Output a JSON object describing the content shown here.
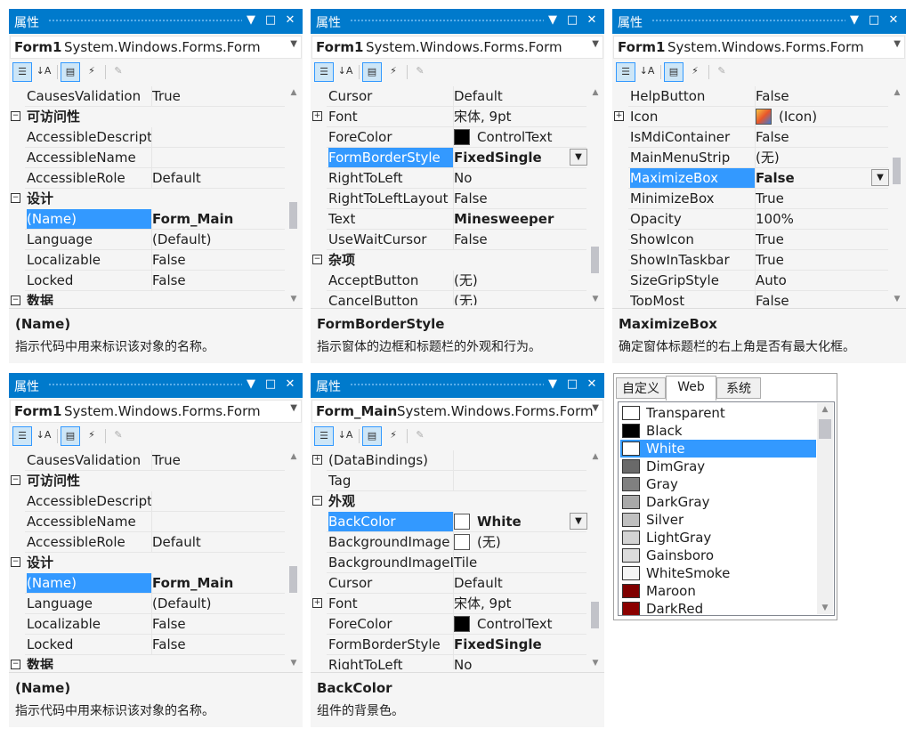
{
  "panes": [
    {
      "title": "属性",
      "object_name": "Form1",
      "object_type": "System.Windows.Forms.Form",
      "rows": [
        {
          "name": "CausesValidation",
          "value": "True"
        },
        {
          "name": "可访问性",
          "category": true
        },
        {
          "name": "AccessibleDescript",
          "value": ""
        },
        {
          "name": "AccessibleName",
          "value": ""
        },
        {
          "name": "AccessibleRole",
          "value": "Default"
        },
        {
          "name": "设计",
          "category": true
        },
        {
          "name": "(Name)",
          "value": "Form_Main",
          "selected": true,
          "bold": true
        },
        {
          "name": "Language",
          "value": "(Default)"
        },
        {
          "name": "Localizable",
          "value": "False"
        },
        {
          "name": "Locked",
          "value": "False"
        },
        {
          "name": "数据",
          "category": true
        }
      ],
      "desc_title": "(Name)",
      "desc_text": "指示代码中用来标识该对象的名称。"
    },
    {
      "title": "属性",
      "object_name": "Form1",
      "object_type": "System.Windows.Forms.Form",
      "rows": [
        {
          "name": "Cursor",
          "value": "Default"
        },
        {
          "name": "Font",
          "value": "宋体, 9pt",
          "expand": true
        },
        {
          "name": "ForeColor",
          "value": "ControlText",
          "swatch": "#000000"
        },
        {
          "name": "FormBorderStyle",
          "value": "FixedSingle",
          "selected": true,
          "bold": true,
          "dropdown": true
        },
        {
          "name": "RightToLeft",
          "value": "No"
        },
        {
          "name": "RightToLeftLayout",
          "value": "False"
        },
        {
          "name": "Text",
          "value": "Minesweeper",
          "bold": true
        },
        {
          "name": "UseWaitCursor",
          "value": "False"
        },
        {
          "name": "杂项",
          "category": true
        },
        {
          "name": "AcceptButton",
          "value": "(无)"
        },
        {
          "name": "CancelButton",
          "value": "(无)"
        }
      ],
      "desc_title": "FormBorderStyle",
      "desc_text": "指示窗体的边框和标题栏的外观和行为。"
    },
    {
      "title": "属性",
      "object_name": "Form1",
      "object_type": "System.Windows.Forms.Form",
      "rows": [
        {
          "name": "HelpButton",
          "value": "False"
        },
        {
          "name": "Icon",
          "value": "(Icon)",
          "expand": true,
          "icon": true
        },
        {
          "name": "IsMdiContainer",
          "value": "False"
        },
        {
          "name": "MainMenuStrip",
          "value": "(无)"
        },
        {
          "name": "MaximizeBox",
          "value": "False",
          "selected": true,
          "bold": true,
          "dropdown": true
        },
        {
          "name": "MinimizeBox",
          "value": "True"
        },
        {
          "name": "Opacity",
          "value": "100%"
        },
        {
          "name": "ShowIcon",
          "value": "True"
        },
        {
          "name": "ShowInTaskbar",
          "value": "True"
        },
        {
          "name": "SizeGripStyle",
          "value": "Auto"
        },
        {
          "name": "TopMost",
          "value": "False"
        }
      ],
      "desc_title": "MaximizeBox",
      "desc_text": "确定窗体标题栏的右上角是否有最大化框。"
    },
    {
      "title": "属性",
      "object_name": "Form1",
      "object_type": "System.Windows.Forms.Form",
      "rows": [
        {
          "name": "CausesValidation",
          "value": "True"
        },
        {
          "name": "可访问性",
          "category": true
        },
        {
          "name": "AccessibleDescript",
          "value": ""
        },
        {
          "name": "AccessibleName",
          "value": ""
        },
        {
          "name": "AccessibleRole",
          "value": "Default"
        },
        {
          "name": "设计",
          "category": true
        },
        {
          "name": "(Name)",
          "value": "Form_Main",
          "selected": true,
          "bold": true
        },
        {
          "name": "Language",
          "value": "(Default)"
        },
        {
          "name": "Localizable",
          "value": "False"
        },
        {
          "name": "Locked",
          "value": "False"
        },
        {
          "name": "数据",
          "category": true
        }
      ],
      "desc_title": "(Name)",
      "desc_text": "指示代码中用来标识该对象的名称。"
    },
    {
      "title": "属性",
      "object_name": "Form_Main",
      "object_type": "System.Windows.Forms.Form",
      "rows": [
        {
          "name": "(DataBindings)",
          "value": "",
          "expand": true
        },
        {
          "name": "Tag",
          "value": ""
        },
        {
          "name": "外观",
          "category": true
        },
        {
          "name": "BackColor",
          "value": "White",
          "selected": true,
          "bold": true,
          "dropdown": true,
          "swatch": "#ffffff"
        },
        {
          "name": "BackgroundImage",
          "value": "(无)",
          "swatch": "#ffffff"
        },
        {
          "name": "BackgroundImageLayout",
          "value": "Tile"
        },
        {
          "name": "Cursor",
          "value": "Default"
        },
        {
          "name": "Font",
          "value": "宋体, 9pt",
          "expand": true
        },
        {
          "name": "ForeColor",
          "value": "ControlText",
          "swatch": "#000000"
        },
        {
          "name": "FormBorderStyle",
          "value": "FixedSingle",
          "bold": true
        },
        {
          "name": "RightToLeft",
          "value": "No"
        }
      ],
      "desc_title": "BackColor",
      "desc_text": "组件的背景色。"
    }
  ],
  "color_picker": {
    "tabs": [
      "自定义",
      "Web",
      "系统"
    ],
    "active_tab": 1,
    "items": [
      {
        "name": "Transparent",
        "color": "#ffffff"
      },
      {
        "name": "Black",
        "color": "#000000"
      },
      {
        "name": "White",
        "color": "#ffffff",
        "selected": true
      },
      {
        "name": "DimGray",
        "color": "#696969"
      },
      {
        "name": "Gray",
        "color": "#808080"
      },
      {
        "name": "DarkGray",
        "color": "#a9a9a9"
      },
      {
        "name": "Silver",
        "color": "#c0c0c0"
      },
      {
        "name": "LightGray",
        "color": "#d3d3d3"
      },
      {
        "name": "Gainsboro",
        "color": "#dcdcdc"
      },
      {
        "name": "WhiteSmoke",
        "color": "#f5f5f5"
      },
      {
        "name": "Maroon",
        "color": "#800000"
      },
      {
        "name": "DarkRed",
        "color": "#8b0000"
      }
    ]
  }
}
